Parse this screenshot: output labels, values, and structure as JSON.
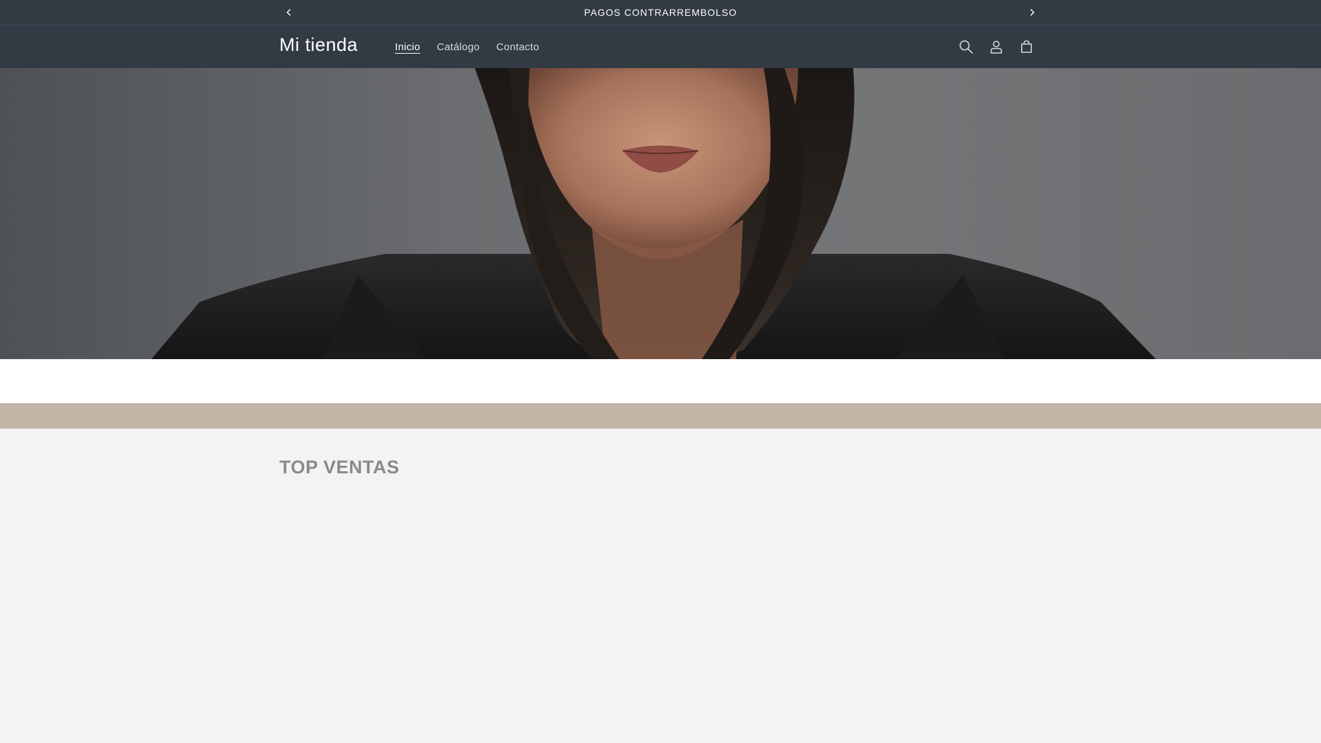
{
  "announcement": {
    "text": "PAGOS CONTRARREMBOLSO",
    "prev_icon": "chevron-left-icon",
    "next_icon": "chevron-right-icon"
  },
  "header": {
    "logo": "Mi tienda",
    "nav": [
      {
        "label": "Inicio",
        "active": true
      },
      {
        "label": "Catálogo",
        "active": false
      },
      {
        "label": "Contacto",
        "active": false
      }
    ],
    "icons": [
      "search-icon",
      "account-icon",
      "cart-icon"
    ]
  },
  "hero": {
    "image": "woman-portrait-dark-bob-hair"
  },
  "colors": {
    "header_bg": "#323a44",
    "band": "#c2b5a8",
    "body_bg": "#f3f3f3",
    "white": "#ffffff"
  },
  "featured": {
    "title": "TOP VENTAS"
  }
}
